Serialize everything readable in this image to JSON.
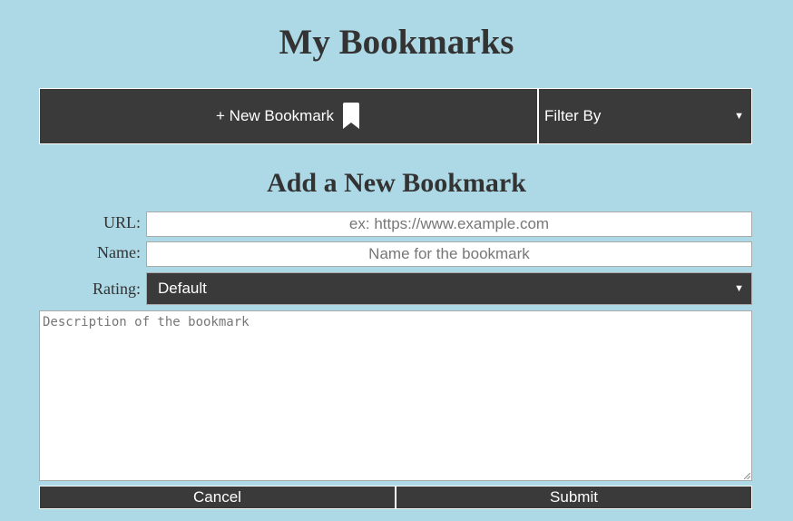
{
  "header": {
    "title": "My Bookmarks"
  },
  "toolbar": {
    "new_bookmark_label": "+ New Bookmark",
    "new_bookmark_icon": "bookmark-icon",
    "filter_label": "Filter By",
    "filter_caret": "▼"
  },
  "form": {
    "title": "Add a New Bookmark",
    "url": {
      "label": "URL:",
      "placeholder": "ex: https://www.example.com",
      "value": ""
    },
    "name": {
      "label": "Name:",
      "placeholder": "Name for the bookmark",
      "value": ""
    },
    "rating": {
      "label": "Rating:",
      "selected": "Default",
      "caret": "▼"
    },
    "description": {
      "placeholder": "Description of the bookmark",
      "value": ""
    },
    "cancel_label": "Cancel",
    "submit_label": "Submit"
  },
  "colors": {
    "background": "#add8e6",
    "control_dark": "#3a3a3a",
    "text": "#333333",
    "white": "#ffffff"
  }
}
